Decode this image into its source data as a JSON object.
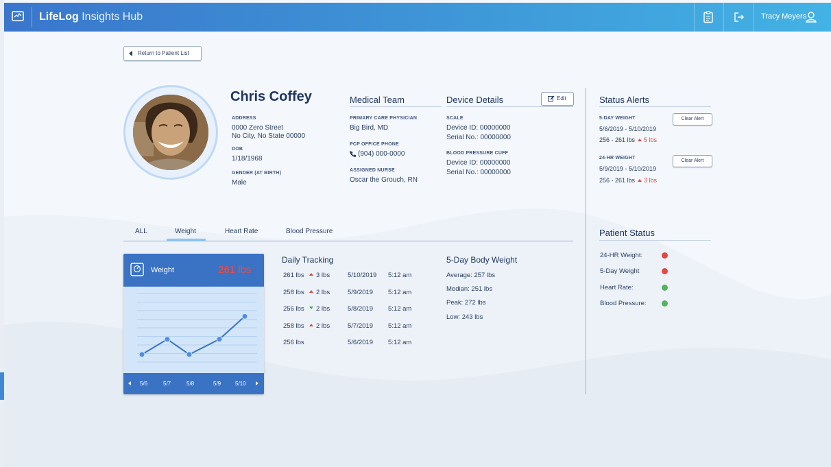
{
  "header": {
    "app_name_bold": "LifeLog",
    "app_name_light": "Insights Hub",
    "user_name": "Tracy Meyers",
    "icons": [
      "monitor-icon",
      "clipboard-icon",
      "logout-icon",
      "user-icon"
    ]
  },
  "back_button": "Return to Patient List",
  "patient": {
    "name": "Chris Coffey",
    "address_label": "ADDRESS",
    "address_line1": "0000 Zero Street",
    "address_line2": "No City, No State 00000",
    "dob_label": "DOB",
    "dob": "1/18/1968",
    "gender_label": "GENDER (AT BIRTH)",
    "gender": "Male"
  },
  "medical_team": {
    "title": "Medical Team",
    "pcp_label": "PRIMARY CARE PHYSICIAN",
    "pcp": "Big Bird, MD",
    "phone_label": "PCP OFFICE PHONE",
    "phone": "(904) 000-0000",
    "nurse_label": "ASSIGNED NURSE",
    "nurse": "Oscar the Grouch, RN"
  },
  "device_details": {
    "title": "Device Details",
    "edit_label": "Edit",
    "scale_label": "SCALE",
    "scale_device_id": "Device ID: 00000000",
    "scale_serial": "Serial No.: 00000000",
    "bp_label": "BLOOD PRESSURE CUFF",
    "bp_device_id": "Device ID: 00000000",
    "bp_serial": "Serial No.: 00000000"
  },
  "status_alerts": {
    "title": "Status Alerts",
    "alerts": [
      {
        "label": "5-DAY WEIGHT",
        "dates": "5/6/2019 - 5/10/2019",
        "range": "256 - 261 lbs",
        "delta": "5 lbs",
        "button": "Clear Alert"
      },
      {
        "label": "24-HR WEIGHT",
        "dates": "5/9/2019 - 5/10/2019",
        "range": "256 - 261 lbs",
        "delta": "3 lbs",
        "button": "Clear Alert"
      }
    ]
  },
  "tabs": [
    "ALL",
    "Weight",
    "Heart Rate",
    "Blood Pressure"
  ],
  "active_tab": "Weight",
  "weight_card": {
    "title": "Weight",
    "current": "261 lbs",
    "accent": "#3a72c4",
    "value_color": "#f24a45"
  },
  "chart_data": {
    "type": "line",
    "categories": [
      "5/6",
      "5/7",
      "5/8",
      "5/9",
      "5/10"
    ],
    "values": [
      256,
      258,
      256,
      258,
      261
    ],
    "ylim": [
      255,
      264
    ]
  },
  "daily_tracking": {
    "title": "Daily Tracking",
    "rows": [
      {
        "weight": "261 lbs",
        "delta": "3 lbs",
        "dir": "up",
        "date": "5/10/2019",
        "time": "5:12 am"
      },
      {
        "weight": "258 lbs",
        "delta": "2 lbs",
        "dir": "up",
        "date": "5/9/2019",
        "time": "5:12 am"
      },
      {
        "weight": "256 lbs",
        "delta": "2 lbs",
        "dir": "down",
        "date": "5/8/2019",
        "time": "5:12 am"
      },
      {
        "weight": "258 lbs",
        "delta": "2 lbs",
        "dir": "up",
        "date": "5/7/2019",
        "time": "5:12 am"
      },
      {
        "weight": "256 lbs",
        "delta": "",
        "dir": "",
        "date": "5/6/2019",
        "time": "5:12 am"
      }
    ]
  },
  "body_weight": {
    "title": "5-Day Body Weight",
    "average": "Average: 257 lbs",
    "median": "Median: 251 lbs",
    "peak": "Peak: 272 lbs",
    "low": "Low: 243 lbs"
  },
  "patient_status": {
    "title": "Patient Status",
    "items": [
      {
        "label": "24-HR Weight:",
        "color": "#e8453f"
      },
      {
        "label": "5-Day Weight",
        "color": "#e8453f"
      },
      {
        "label": "Heart Rate:",
        "color": "#52b55e"
      },
      {
        "label": "Blood Pressure:",
        "color": "#52b55e"
      }
    ]
  }
}
